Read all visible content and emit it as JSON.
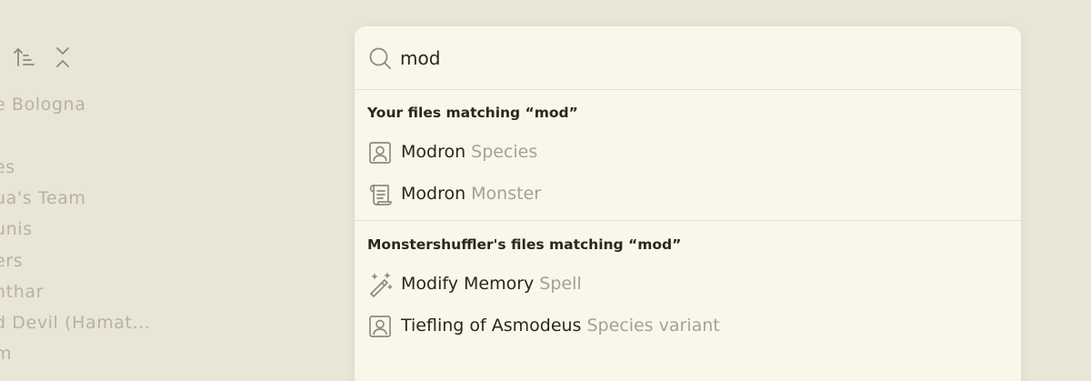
{
  "sidebar": {
    "toolbar": {
      "sort_icon": "sort-ascending-icon",
      "collapse_icon": "collapse-all-icon"
    },
    "items": [
      {
        "label": "e Bologna"
      },
      {
        "label": "es"
      },
      {
        "label": "ua's Team"
      },
      {
        "label": "unis"
      },
      {
        "label": "ers"
      },
      {
        "label": "nthar"
      },
      {
        "label": "d Devil (Hamat..."
      },
      {
        "label": "m"
      }
    ]
  },
  "palette": {
    "search": {
      "value": "mod",
      "icon": "search-icon"
    },
    "sections": [
      {
        "header": "Your files matching “mod”",
        "results": [
          {
            "name": "Modron",
            "type": "Species",
            "icon": "person-portrait-icon"
          },
          {
            "name": "Modron",
            "type": "Monster",
            "icon": "scroll-icon"
          }
        ]
      },
      {
        "header": "Monstershuffler's files matching “mod”",
        "results": [
          {
            "name": "Modify Memory",
            "type": "Spell",
            "icon": "magic-wand-icon"
          },
          {
            "name": "Tiefling of Asmodeus",
            "type": "Species variant",
            "icon": "person-portrait-icon"
          }
        ]
      }
    ]
  },
  "colors": {
    "background": "#e9e5d7",
    "panel": "#f9f6ea",
    "text": "#2a2721",
    "muted": "#a6a194",
    "faded": "#b7b2a3"
  }
}
